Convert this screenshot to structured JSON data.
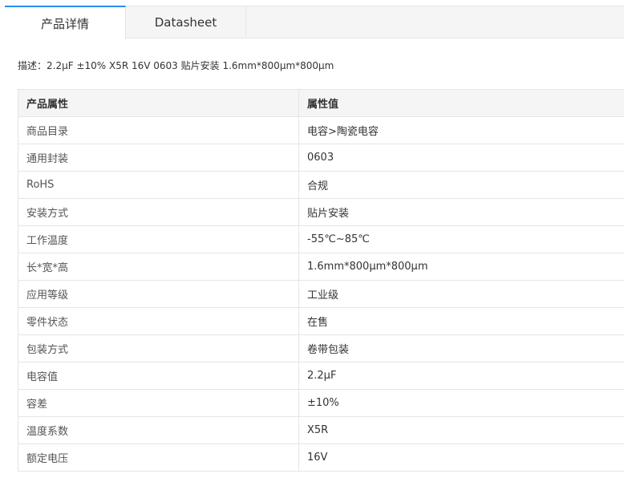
{
  "tabs": {
    "detail_label": "产品详情",
    "datasheet_label": "Datasheet"
  },
  "description": "描述：2.2µF ±10% X5R 16V 0603 贴片安装 1.6mm*800µm*800µm",
  "table": {
    "headers": [
      "产品属性",
      "属性值"
    ],
    "rows": [
      {
        "key": "商品目录",
        "value": "电容>陶瓷电容"
      },
      {
        "key": "通用封装",
        "value": "0603"
      },
      {
        "key": "RoHS",
        "value": "合规"
      },
      {
        "key": "安装方式",
        "value": "贴片安装"
      },
      {
        "key": "工作温度",
        "value": "-55℃~85℃"
      },
      {
        "key": "长*宽*高",
        "value": "1.6mm*800µm*800µm"
      },
      {
        "key": "应用等级",
        "value": "工业级"
      },
      {
        "key": "零件状态",
        "value": "在售"
      },
      {
        "key": "包装方式",
        "value": "卷带包装"
      },
      {
        "key": "电容值",
        "value": "2.2µF"
      },
      {
        "key": "容差",
        "value": "±10%"
      },
      {
        "key": "温度系数",
        "value": "X5R"
      },
      {
        "key": "额定电压",
        "value": "16V"
      }
    ]
  },
  "colors": {
    "accent": "#2a8cf0",
    "header_bg": "#f5f5f5",
    "border": "#e5e5e5"
  }
}
